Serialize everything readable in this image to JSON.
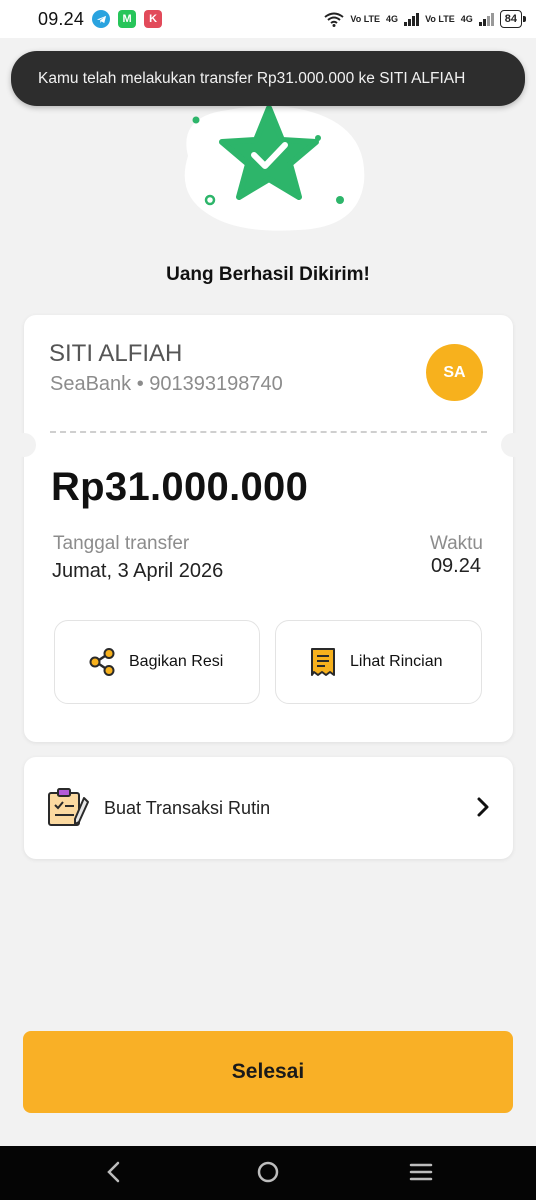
{
  "status_bar": {
    "time": "09.24",
    "sim1": "Vo LTE",
    "sim2": "Vo LTE",
    "net1": "4G",
    "net2": "4G",
    "battery": "84",
    "icons": [
      "telegram-icon",
      "m-app-icon",
      "k-app-icon",
      "wifi-icon",
      "signal-icon",
      "battery-icon"
    ]
  },
  "toast": {
    "message": "Kamu telah melakukan transfer Rp31.000.000 ke SITI ALFIAH"
  },
  "hero": {
    "title": "Uang Berhasil Dikirim!",
    "icon": "success-star-check-icon",
    "accent": "#2db56a"
  },
  "receipt": {
    "recipient_name": "SITI ALFIAH",
    "recipient_account": "SeaBank • 901393198740",
    "avatar_initials": "SA",
    "avatar_color": "#f7b11d",
    "amount": "Rp31.000.000",
    "date_label": "Tanggal transfer",
    "date_value": "Jumat, 3 April 2026",
    "time_label": "Waktu",
    "time_value": "09.24",
    "share_label": "Bagikan Resi",
    "details_label": "Lihat Rincian"
  },
  "routine": {
    "label": "Buat Transaksi Rutin"
  },
  "done_button": {
    "label": "Selesai",
    "color": "#f9b026"
  },
  "nav": {
    "icons": [
      "back-icon",
      "home-icon",
      "menu-icon"
    ]
  }
}
